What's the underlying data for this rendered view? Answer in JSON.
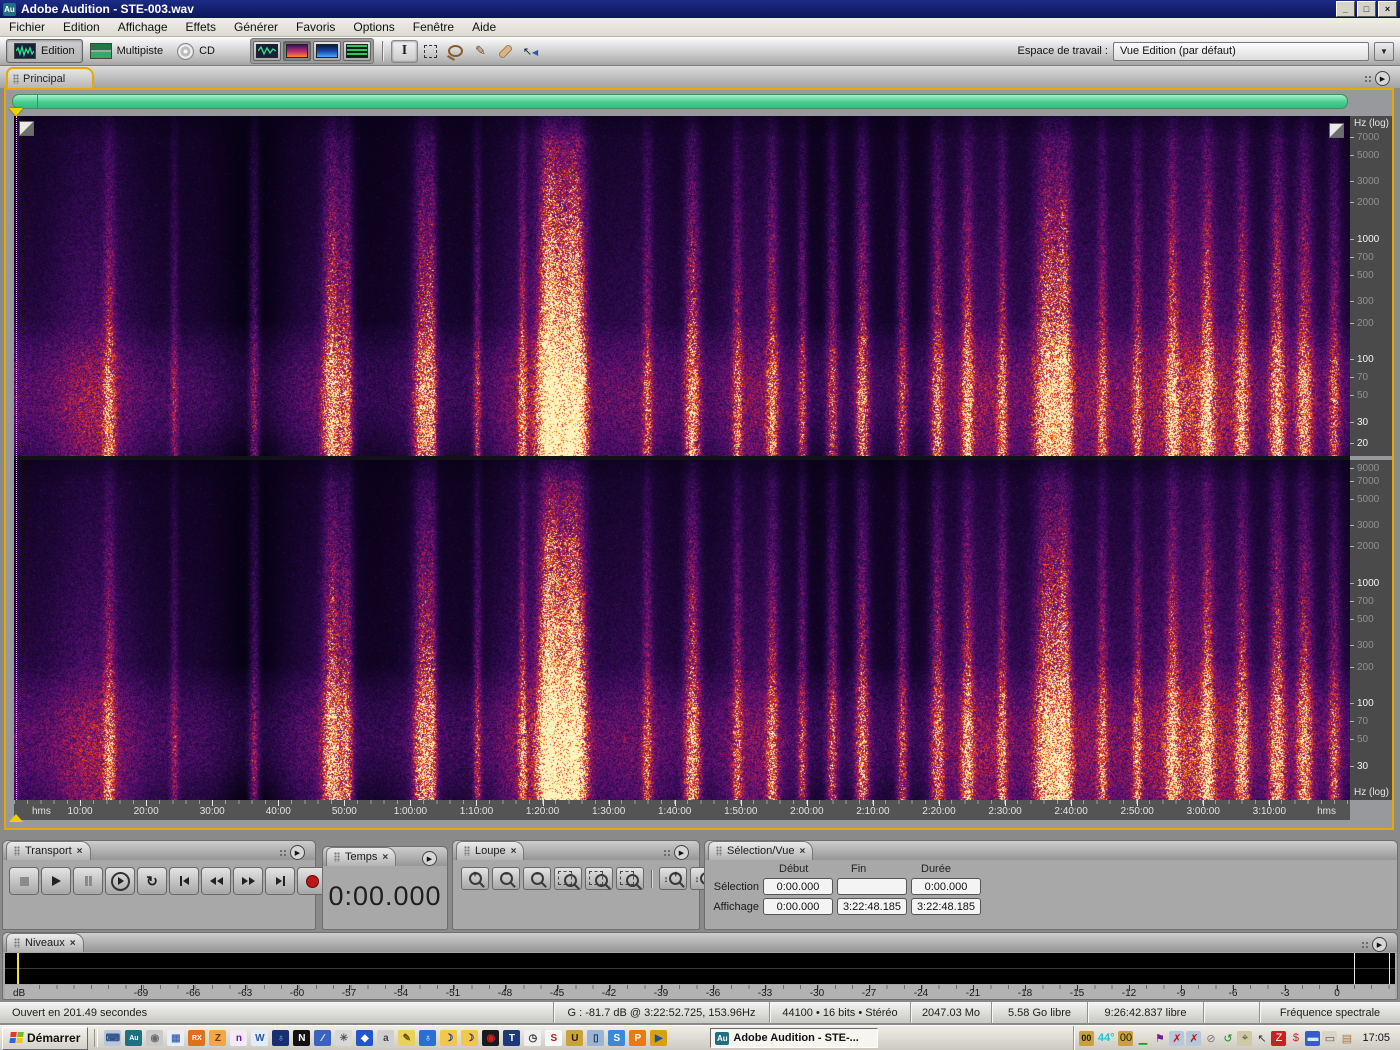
{
  "titlebar": {
    "icon": "Au",
    "title": "Adobe Audition - STE-003.wav",
    "minimize_glyph": "_",
    "maximize_glyph": "□",
    "close_glyph": "×"
  },
  "menubar": {
    "items": [
      "Fichier",
      "Edition",
      "Affichage",
      "Effets",
      "Générer",
      "Favoris",
      "Options",
      "Fenêtre",
      "Aide"
    ]
  },
  "toolbar": {
    "modes": [
      {
        "label": "Edition"
      },
      {
        "label": "Multipiste"
      },
      {
        "label": "CD"
      }
    ],
    "workspace_label": "Espace de travail :",
    "workspace_value": "Vue Edition (par défaut)"
  },
  "tabs": {
    "main": "Principal"
  },
  "spectral": {
    "freq_axis_title": "Hz (log)",
    "freq_ticks_top": [
      "7000",
      "5000",
      "3000",
      "2000",
      "1000",
      "700",
      "500",
      "300",
      "200",
      "100",
      "70",
      "50",
      "30",
      "20"
    ],
    "freq_ticks_bottom": [
      "9000",
      "7000",
      "5000",
      "3000",
      "2000",
      "1000",
      "700",
      "500",
      "300",
      "200",
      "100",
      "70",
      "50",
      "30"
    ],
    "bright_ticks": [
      "1000",
      "100",
      "20",
      "30"
    ],
    "time_unit": "hms",
    "time_ticks": [
      "10:00",
      "20:00",
      "30:00",
      "40:00",
      "50:00",
      "1:00:00",
      "1:10:00",
      "1:20:00",
      "1:30:00",
      "1:40:00",
      "1:50:00",
      "2:00:00",
      "2:10:00",
      "2:20:00",
      "2:30:00",
      "2:40:00",
      "2:50:00",
      "3:00:00",
      "3:10:00"
    ],
    "palette": {
      "background": "#0a0319",
      "low": "#2a0845",
      "mid": "#7a1668",
      "high": "#d83020",
      "peak": "#ffb43a"
    }
  },
  "transport": {
    "title": "Transport"
  },
  "time_panel": {
    "title": "Temps",
    "value": "0:00.000"
  },
  "zoom_panel": {
    "title": "Loupe"
  },
  "selection_panel": {
    "title": "Sélection/Vue",
    "columns": [
      "Début",
      "Fin",
      "Durée"
    ],
    "rows": [
      {
        "label": "Sélection",
        "debut": "0:00.000",
        "fin": "",
        "duree": "0:00.000"
      },
      {
        "label": "Affichage",
        "debut": "0:00.000",
        "fin": "3:22:48.185",
        "duree": "3:22:48.185"
      }
    ]
  },
  "levels_panel": {
    "title": "Niveaux",
    "unit": "dB",
    "ticks": [
      "-69",
      "-66",
      "-63",
      "-60",
      "-57",
      "-54",
      "-51",
      "-48",
      "-45",
      "-42",
      "-39",
      "-36",
      "-33",
      "-30",
      "-27",
      "-24",
      "-21",
      "-18",
      "-15",
      "-12",
      "-9",
      "-6",
      "-3",
      "0"
    ]
  },
  "statusbar": {
    "segments": [
      "Ouvert en 201.49 secondes",
      "G : -81.7 dB @ 3:22:52.725, 153.96Hz",
      "44100 • 16 bits • Stéréo",
      "2047.03 Mo",
      "5.58 Go libre",
      "9:26:42.837 libre",
      "",
      "Fréquence spectrale"
    ]
  },
  "taskbar": {
    "start": "Démarrer",
    "task_button": "Adobe Audition - STE-...",
    "quicklaunch": [
      {
        "name": "show-desktop-icon",
        "glyph": "⌨",
        "bg": "#b9c7de",
        "fg": "#2f4f86"
      },
      {
        "name": "audition-icon",
        "glyph": "Au",
        "bg": "#1f7080",
        "fg": "#ffffff"
      },
      {
        "name": "player-circle-icon",
        "glyph": "◉",
        "bg": "#c9c9c9",
        "fg": "#6a6a6a"
      },
      {
        "name": "calculator-icon",
        "glyph": "▦",
        "bg": "#e8eef8",
        "fg": "#4a6fb5"
      },
      {
        "name": "rx-icon",
        "glyph": "RX",
        "bg": "#e07020",
        "fg": "#ffffff"
      },
      {
        "name": "zip-icon",
        "glyph": "Z",
        "bg": "#f0a845",
        "fg": "#7c3500"
      },
      {
        "name": "onenote-icon",
        "glyph": "n",
        "bg": "#f3eaf9",
        "fg": "#7719aa"
      },
      {
        "name": "word-icon",
        "glyph": "W",
        "bg": "#e3ecfa",
        "fg": "#2b579a"
      },
      {
        "name": "planet-icon",
        "glyph": "♁",
        "bg": "#1a2f6e",
        "fg": "#9fc0ff"
      },
      {
        "name": "n-app-icon",
        "glyph": "N",
        "bg": "#111111",
        "fg": "#ffffff"
      },
      {
        "name": "wand-icon",
        "glyph": "∕",
        "bg": "#3a62c0",
        "fg": "#ffffff"
      },
      {
        "name": "burst-icon",
        "glyph": "✳",
        "bg": "#d8d8d8",
        "fg": "#555555"
      },
      {
        "name": "diamond-doc-icon",
        "glyph": "◆",
        "bg": "#2255cc",
        "fg": "#ffffff"
      },
      {
        "name": "letter-a-icon",
        "glyph": "a",
        "bg": "#cfcfcf",
        "fg": "#444444"
      },
      {
        "name": "tools-icon",
        "glyph": "✎",
        "bg": "#e8d25a",
        "fg": "#6a4a00"
      },
      {
        "name": "globe-icon",
        "glyph": "♁",
        "bg": "#2b6fd4",
        "fg": "#ffffff"
      },
      {
        "name": "moon-icon-1",
        "glyph": "☽",
        "bg": "#f2c84b",
        "fg": "#1a3a8a"
      },
      {
        "name": "moon-icon-2",
        "glyph": "☽",
        "bg": "#f2c84b",
        "fg": "#1a3a8a"
      },
      {
        "name": "eye-icon",
        "glyph": "◉",
        "bg": "#1a1a1a",
        "fg": "#d42020"
      },
      {
        "name": "tc-icon",
        "glyph": "T",
        "bg": "#1a3a7a",
        "fg": "#ffffff"
      },
      {
        "name": "compass-icon",
        "glyph": "◷",
        "bg": "#f0f0f0",
        "fg": "#333333"
      },
      {
        "name": "sbp-icon",
        "glyph": "S",
        "bg": "#f8f8f8",
        "fg": "#c01818"
      },
      {
        "name": "ue-icon",
        "glyph": "U",
        "bg": "#caa23a",
        "fg": "#2a1a00"
      },
      {
        "name": "pda-icon",
        "glyph": "▯",
        "bg": "#9ab4d8",
        "fg": "#223344"
      },
      {
        "name": "sync-icon",
        "glyph": "S",
        "bg": "#3a8ad8",
        "fg": "#ffffff"
      },
      {
        "name": "pdf-icon",
        "glyph": "P",
        "bg": "#e87a10",
        "fg": "#ffffff"
      },
      {
        "name": "mediaplayer-icon",
        "glyph": "▶",
        "bg": "#d8a018",
        "fg": "#1a52a0"
      }
    ],
    "tray": {
      "temperature": "44°",
      "clock": "17:05",
      "icons": [
        {
          "name": "meter-00-icon",
          "glyph": "00",
          "bg": "#caa23a",
          "fg": "#1a1a1a"
        },
        {
          "name": "minimized-strip-icon",
          "glyph": "▁",
          "bg": "",
          "fg": "#1a9a1a"
        },
        {
          "name": "flag-icon",
          "glyph": "⚑",
          "bg": "",
          "fg": "#7a1a9a"
        },
        {
          "name": "network-offline-icon-1",
          "glyph": "✗",
          "bg": "#b8c8dc",
          "fg": "#cc1111"
        },
        {
          "name": "network-offline-icon-2",
          "glyph": "✗",
          "bg": "#b8c8dc",
          "fg": "#cc1111"
        },
        {
          "name": "blocked-icon",
          "glyph": "⊘",
          "bg": "",
          "fg": "#7a7a7a"
        },
        {
          "name": "update-icon",
          "glyph": "↺",
          "bg": "",
          "fg": "#1a8a1a"
        },
        {
          "name": "scanner-icon",
          "glyph": "⌖",
          "bg": "#cfc9a8",
          "fg": "#55512a"
        },
        {
          "name": "pointer-icon",
          "glyph": "↖",
          "bg": "",
          "fg": "#333333"
        },
        {
          "name": "zonealarm-icon",
          "glyph": "Z",
          "bg": "#cc2020",
          "fg": "#ffffff"
        },
        {
          "name": "money-icon",
          "glyph": "$",
          "bg": "",
          "fg": "#cc2020"
        },
        {
          "name": "display-icon",
          "glyph": "▬",
          "bg": "#3a5aca",
          "fg": "#cceeff"
        },
        {
          "name": "mouse-icon",
          "glyph": "▭",
          "bg": "#d8d4c8",
          "fg": "#555555"
        },
        {
          "name": "folder-tray-icon",
          "glyph": "▤",
          "bg": "",
          "fg": "#a87840"
        }
      ]
    }
  },
  "colors": {
    "accent_border": "#e8a800",
    "overview_bar": "#49cd8f",
    "titlebar": "#101d69",
    "playhead": "#ffe000"
  }
}
